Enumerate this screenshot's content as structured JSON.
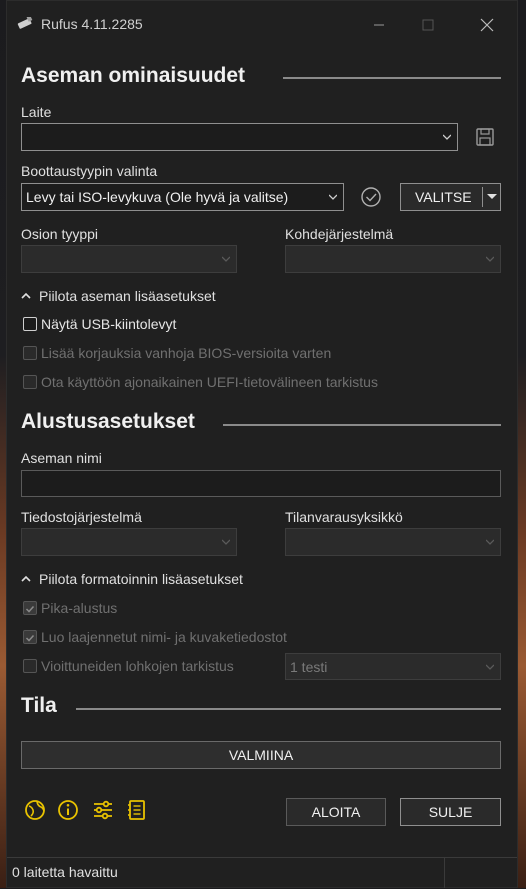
{
  "window": {
    "title": "Rufus 4.11.2285"
  },
  "drive_properties": {
    "heading": "Aseman ominaisuudet",
    "device_label": "Laite",
    "device_value": "",
    "boot_label": "Boottaustyypin valinta",
    "boot_value": "Levy tai ISO-levykuva (Ole hyvä ja valitse)",
    "select_button": "VALITSE",
    "partition_label": "Osion tyyppi",
    "partition_value": "",
    "target_label": "Kohdejärjestelmä",
    "target_value": "",
    "advanced_toggle": "Piilota aseman lisäasetukset",
    "options": [
      {
        "label": "Näytä USB-kiintolevyt",
        "checked": false,
        "enabled": true
      },
      {
        "label": "Lisää korjauksia vanhoja BIOS-versioita varten",
        "checked": false,
        "enabled": false
      },
      {
        "label": "Ota käyttöön ajonaikainen UEFI-tietovälineen tarkistus",
        "checked": false,
        "enabled": false
      }
    ]
  },
  "format_options": {
    "heading": "Alustusasetukset",
    "volume_label": "Aseman nimi",
    "volume_value": "",
    "filesystem_label": "Tiedostojärjestelmä",
    "filesystem_value": "",
    "cluster_label": "Tilanvarausyksikkö",
    "cluster_value": "",
    "advanced_toggle": "Piilota formatoinnin lisäasetukset",
    "options": [
      {
        "label": "Pika-alustus",
        "checked": true,
        "enabled": false
      },
      {
        "label": "Luo laajennetut nimi- ja kuvaketiedostot",
        "checked": true,
        "enabled": false
      },
      {
        "label": "Vioittuneiden lohkojen tarkistus",
        "checked": false,
        "enabled": false
      }
    ],
    "passes_value": "1 testi"
  },
  "status": {
    "heading": "Tila",
    "progress_text": "VALMIINA",
    "progress_fraction": 0
  },
  "actions": {
    "start": "ALOITA",
    "close": "SULJE"
  },
  "footer": {
    "status_text": "0 laitetta havaittu"
  },
  "colors": {
    "accent_icons": "#e8c200",
    "window_bg": "#202020"
  },
  "icons": [
    "app-icon",
    "save-icon",
    "verify-check-icon",
    "globe-icon",
    "info-icon",
    "settings-sliders-icon",
    "log-icon"
  ]
}
